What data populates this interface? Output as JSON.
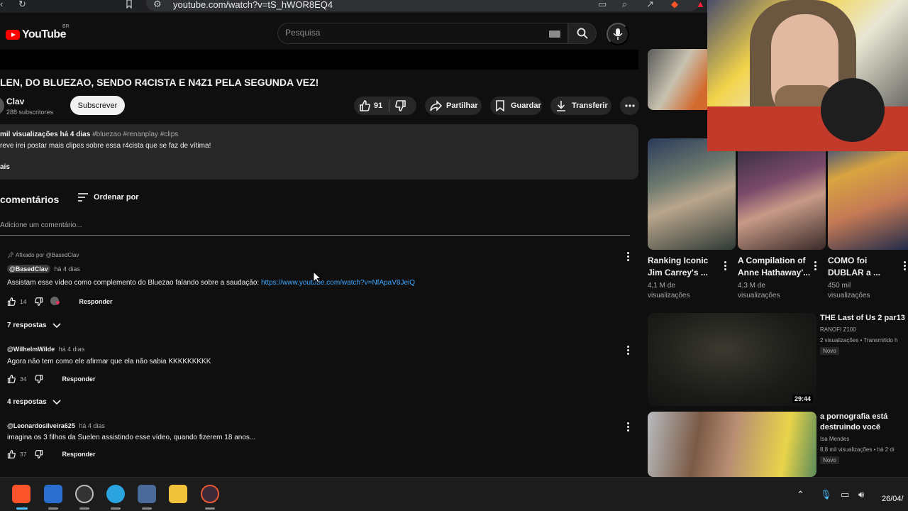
{
  "browser": {
    "url": "youtube.com/watch?v=tS_hWOR8EQ4"
  },
  "header": {
    "logo_text": "YouTube",
    "country_code": "BR",
    "search_placeholder": "Pesquisa"
  },
  "video": {
    "title": "LEN, DO BLUEZAO, SENDO R4CISTA E N4Z1 PELA SEGUNDA VEZ!",
    "channel_name": "Clav",
    "subscribers": "288 subscritores",
    "subscribe_label": "Subscrever",
    "likes": "91",
    "share_label": "Partilhar",
    "save_label": "Guardar",
    "download_label": "Transferir"
  },
  "description": {
    "views_date": "mil visualizações  há 4 dias",
    "tags": "#bluezao #renanplay #clips",
    "text": "reve irei postar mais clipes sobre essa r4cista que se faz de vítima!",
    "more": "ais"
  },
  "comments": {
    "header": "comentários",
    "sort_label": "Ordenar por",
    "add_placeholder": "Adicione um comentário...",
    "items": [
      {
        "pinned": "Afixado por @BasedClav",
        "author": "@BasedClav",
        "time": "há 4 dias",
        "text": "Assistam esse vídeo como complemento do Bluezao falando sobre a saudação: ",
        "link": "https://www.youtube.com/watch?v=NfApaV8JeiQ",
        "likes": "14",
        "reply": "Responder",
        "replies": "7 respostas"
      },
      {
        "author": "@WilhelmWilde",
        "time": "há 4 dias",
        "text": "Agora não tem como ele afirmar que ela não sabia KKKKKKKKK",
        "likes": "34",
        "reply": "Responder",
        "replies": "4 respostas"
      },
      {
        "author": "@Leonardosilveira625",
        "time": "há 4 dias",
        "text": "imagina os 3 filhos da Suelen assistindo esse vídeo, quando fizerem 18 anos...",
        "likes": "37",
        "reply": "Responder"
      }
    ]
  },
  "shorts": [
    {
      "title1": "Ranking Iconic",
      "title2": "Jim Carrey's ...",
      "views1": "4,1 M de",
      "views2": "visualizações"
    },
    {
      "title1": "A Compilation of",
      "title2": "Anne Hathaway'...",
      "views1": "4,3 M de",
      "views2": "visualizações"
    },
    {
      "title1": "COMO foi",
      "title2": "DUBLAR a ...",
      "views1": "450 mil",
      "views2": "visualizações"
    }
  ],
  "recommended": [
    {
      "title": "THE Last of Us 2 par13",
      "channel": "RANOFI Z100",
      "meta": "2 visualizações • Transmitido h",
      "badge": "Novo",
      "duration": "29:44"
    },
    {
      "title1": "a pornografia está",
      "title2": "destruindo você",
      "channel": "Isa Mendes",
      "meta": "8,8 mil visualizações • há 2 di",
      "badge": "Novo"
    }
  ],
  "taskbar": {
    "clock": "26/04/"
  }
}
